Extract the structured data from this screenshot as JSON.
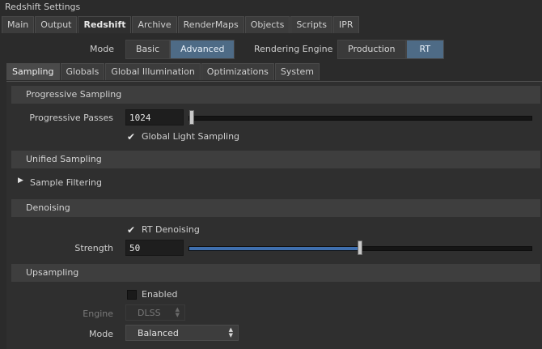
{
  "window": {
    "title": "Redshift Settings"
  },
  "top_tabs": [
    "Main",
    "Output",
    "Redshift",
    "Archive",
    "RenderMaps",
    "Objects",
    "Scripts",
    "IPR"
  ],
  "top_active": "Redshift",
  "mode": {
    "label": "Mode",
    "options": [
      "Basic",
      "Advanced"
    ],
    "selected": "Advanced"
  },
  "engine": {
    "label": "Rendering Engine",
    "options": [
      "Production",
      "RT"
    ],
    "selected": "RT"
  },
  "sub_tabs": [
    "Sampling",
    "Globals",
    "Global Illumination",
    "Optimizations",
    "System"
  ],
  "sub_active": "Sampling",
  "progressive": {
    "header": "Progressive Sampling",
    "passes_label": "Progressive Passes",
    "passes_value": "1024",
    "passes_fraction": 0.01,
    "global_light_label": "Global Light Sampling",
    "global_light_checked": true
  },
  "unified": {
    "header": "Unified Sampling",
    "sample_filtering_label": "Sample Filtering"
  },
  "denoising": {
    "header": "Denoising",
    "rt_denoising_label": "RT Denoising",
    "rt_denoising_checked": true,
    "strength_label": "Strength",
    "strength_value": "50",
    "strength_fraction": 0.5
  },
  "upsampling": {
    "header": "Upsampling",
    "enabled_label": "Enabled",
    "enabled_checked": false,
    "engine_label": "Engine",
    "engine_value": "DLSS",
    "mode_label": "Mode",
    "mode_value": "Balanced"
  },
  "colors": {
    "accent": "#4e6b86",
    "slider_fill": "#3f6fae"
  }
}
